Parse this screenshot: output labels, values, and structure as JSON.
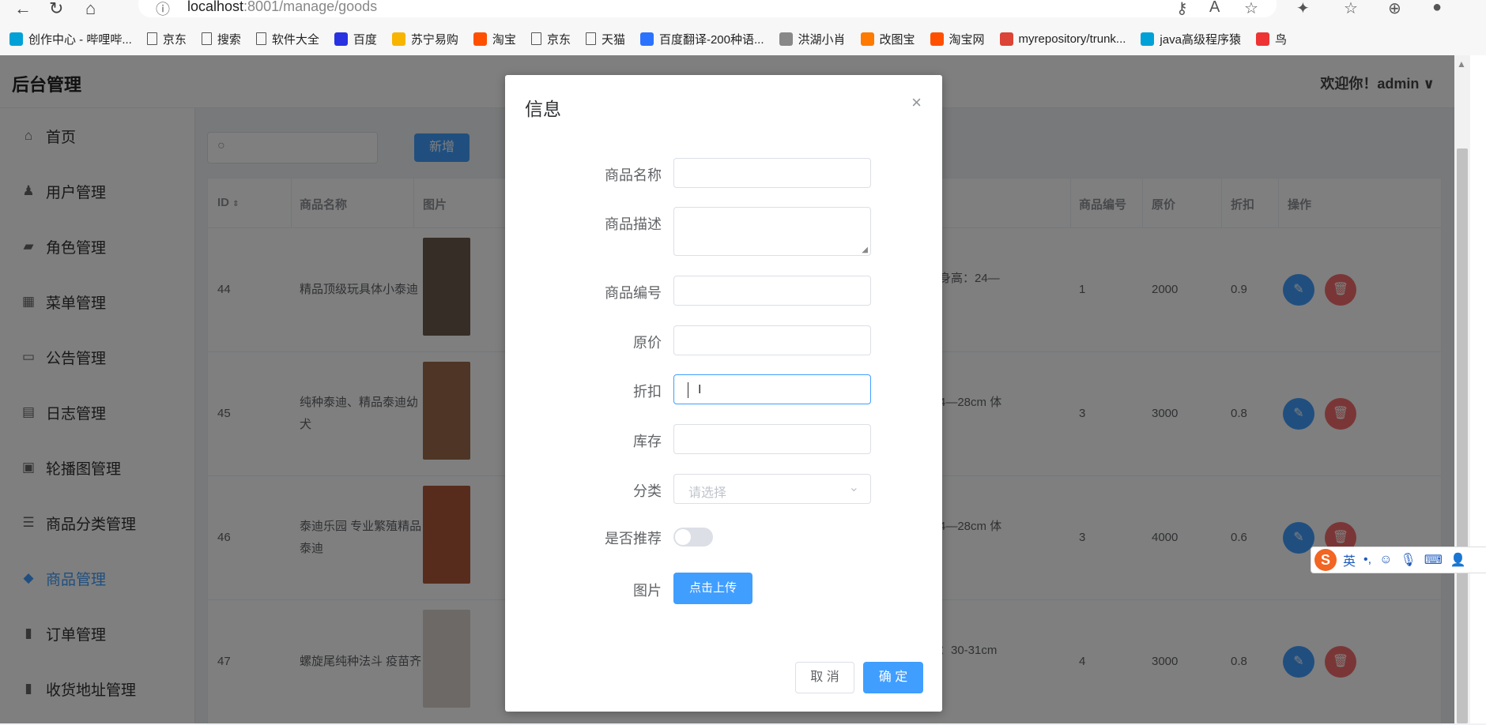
{
  "browser": {
    "url_host": "localhost",
    "url_rest": ":8001/manage/goods",
    "bookmarks": [
      {
        "label": "创作中心 - 哔哩哔...",
        "icon": "bilibili-icon",
        "color": "#00a1d6"
      },
      {
        "label": "京东",
        "icon": "page-icon"
      },
      {
        "label": "搜索",
        "icon": "page-icon"
      },
      {
        "label": "软件大全",
        "icon": "page-icon"
      },
      {
        "label": "百度",
        "icon": "baidu-icon",
        "color": "#2932e1"
      },
      {
        "label": "苏宁易购",
        "icon": "suning-icon",
        "color": "#f7b500"
      },
      {
        "label": "淘宝",
        "icon": "taobao-icon",
        "color": "#ff5000"
      },
      {
        "label": "京东",
        "icon": "page-icon"
      },
      {
        "label": "天猫",
        "icon": "page-icon"
      },
      {
        "label": "百度翻译-200种语...",
        "icon": "baidu-translate-icon",
        "color": "#2b72ff"
      },
      {
        "label": "洪湖小肖",
        "icon": "bird-icon",
        "color": "#888888"
      },
      {
        "label": "改图宝",
        "icon": "gaitubao-icon",
        "color": "#ff7a00"
      },
      {
        "label": "淘宝网",
        "icon": "taobao-icon",
        "color": "#ff5000"
      },
      {
        "label": "myrepository/trunk...",
        "icon": "chrome-icon",
        "color": "#db4437"
      },
      {
        "label": "java高级程序猿",
        "icon": "bilibili-icon",
        "color": "#00a1d6"
      },
      {
        "label": "鸟",
        "icon": "bird-icon",
        "color": "#e33"
      }
    ]
  },
  "header": {
    "brand": "后台管理",
    "welcome": "欢迎你！admin"
  },
  "sidebar": {
    "items": [
      {
        "label": "首页",
        "icon": "home-icon"
      },
      {
        "label": "用户管理",
        "icon": "user-icon"
      },
      {
        "label": "角色管理",
        "icon": "briefcase-icon"
      },
      {
        "label": "菜单管理",
        "icon": "grid-icon"
      },
      {
        "label": "公告管理",
        "icon": "board-icon"
      },
      {
        "label": "日志管理",
        "icon": "document-icon"
      },
      {
        "label": "轮播图管理",
        "icon": "picture-icon"
      },
      {
        "label": "商品分类管理",
        "icon": "list-icon"
      },
      {
        "label": "商品管理",
        "icon": "shopping-bag-icon",
        "active": true
      },
      {
        "label": "订单管理",
        "icon": "bar-chart-icon"
      },
      {
        "label": "收货地址管理",
        "icon": "bar-chart-icon"
      }
    ]
  },
  "toolbar": {
    "add_label": "新增"
  },
  "table": {
    "columns": [
      "ID",
      "商品名称",
      "图片",
      "商品编号",
      "原价",
      "折扣",
      "操作"
    ],
    "rows": [
      {
        "id": "44",
        "name_lines": [
          "精品顶级玩具体小泰迪"
        ],
        "desc": "身高：24—",
        "code": "1",
        "price": "2000",
        "discount": "0.9"
      },
      {
        "id": "45",
        "name_lines": [
          "纯种泰迪、精品泰迪幼",
          "犬"
        ],
        "desc": "4—28cm 体",
        "code": "3",
        "price": "3000",
        "discount": "0.8"
      },
      {
        "id": "46",
        "name_lines": [
          "泰迪乐园 专业繁殖精品",
          "泰迪"
        ],
        "desc": "4—28cm 体",
        "code": "3",
        "price": "4000",
        "discount": "0.6"
      },
      {
        "id": "47",
        "name_lines": [
          "螺旋尾纯种法斗 疫苗齐"
        ],
        "desc": "：30-31cm",
        "code": "4",
        "price": "3000",
        "discount": "0.8"
      }
    ]
  },
  "dialog": {
    "title": "信息",
    "close": "×",
    "fields": {
      "name": "商品名称",
      "description": "商品描述",
      "code": "商品编号",
      "price": "原价",
      "discount": "折扣",
      "stock": "库存",
      "category": "分类",
      "recommend": "是否推荐",
      "image": "图片"
    },
    "category_placeholder": "请选择",
    "upload_label": "点击上传",
    "cancel_label": "取 消",
    "ok_label": "确 定"
  },
  "ime": {
    "lang": "英"
  }
}
